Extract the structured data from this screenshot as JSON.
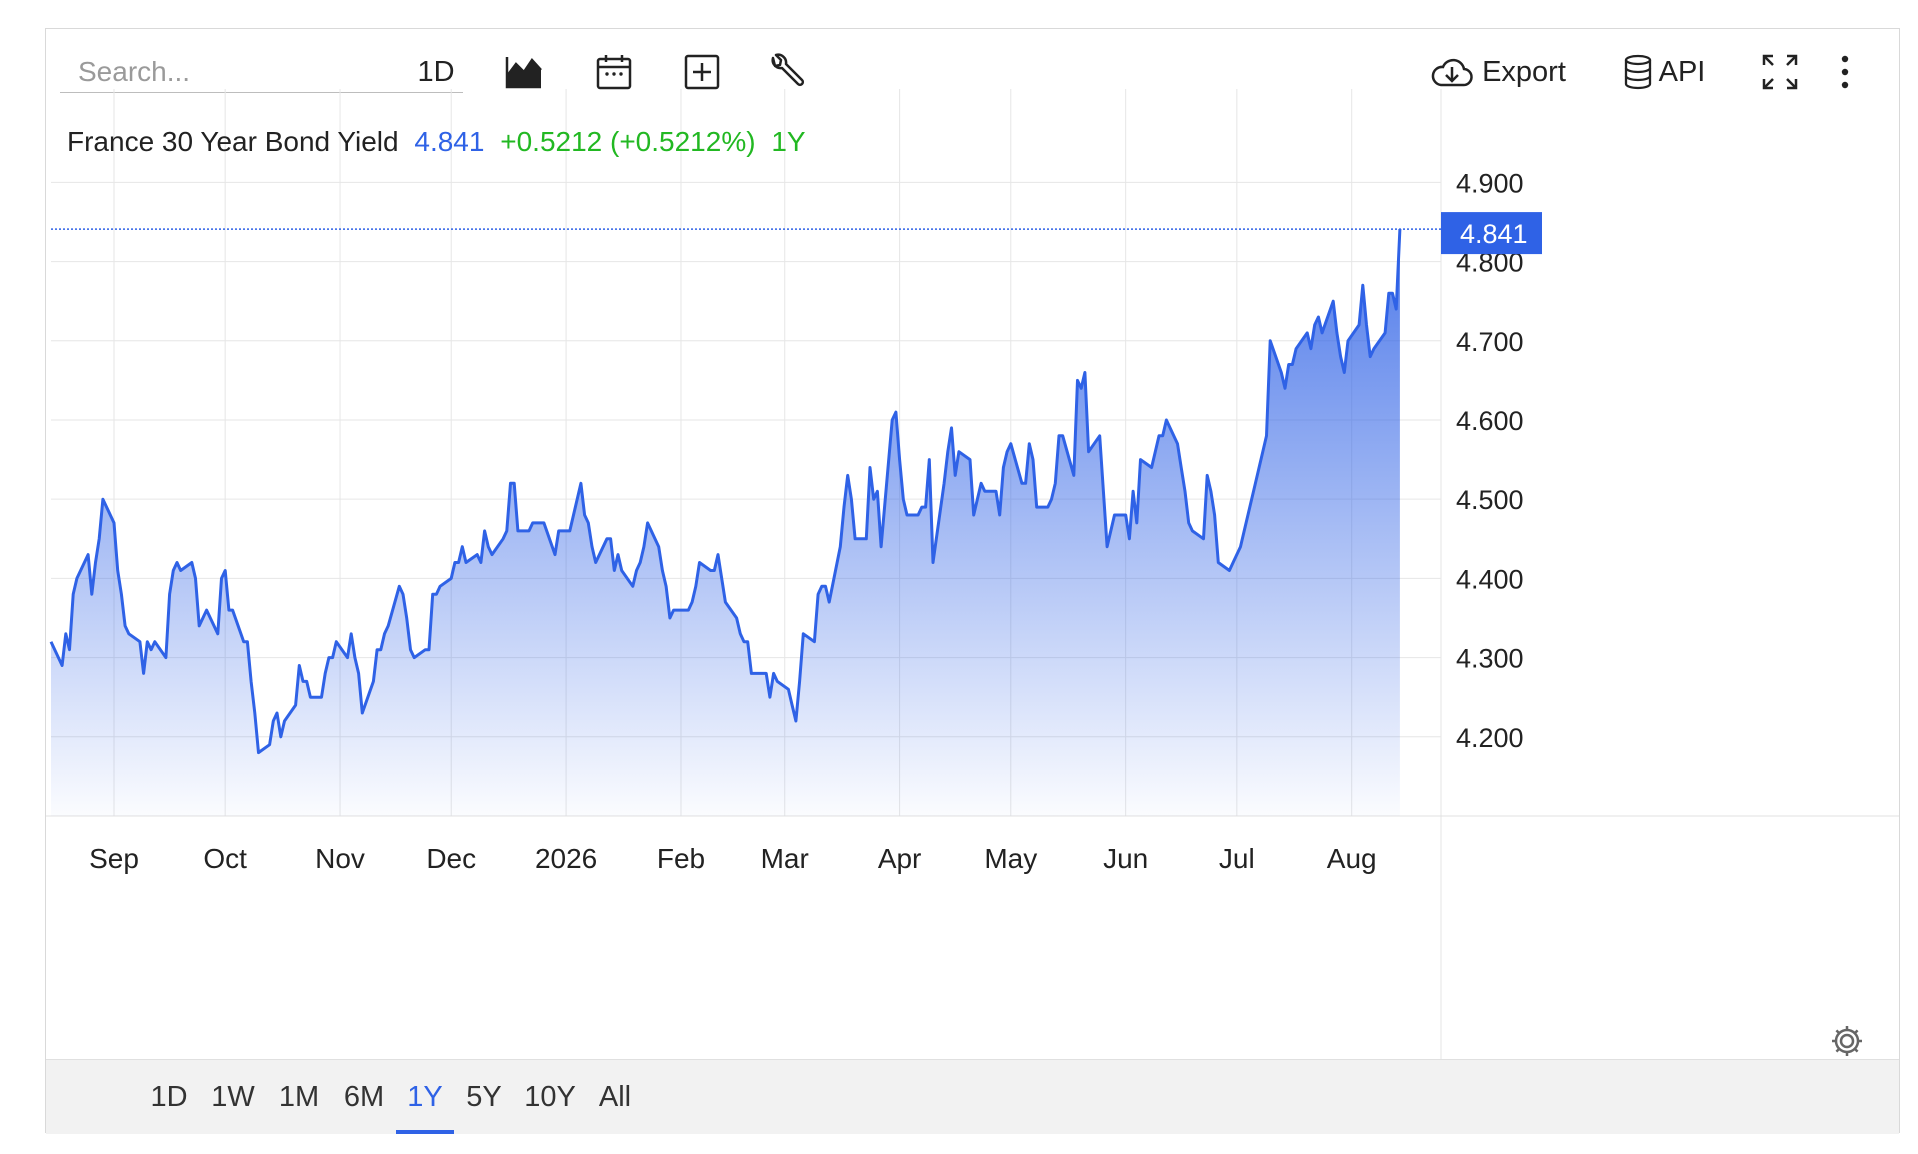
{
  "toolbar": {
    "search_placeholder": "Search...",
    "interval_label": "1D",
    "export_label": "Export",
    "api_label": "API",
    "icons": [
      "chart-type-icon",
      "calendar-icon",
      "compare-plus-icon",
      "wrench-icon",
      "cloud-download-icon",
      "database-icon",
      "fullscreen-icon",
      "more-vertical-icon"
    ]
  },
  "legend": {
    "name": "France 30 Year Bond Yield",
    "value": "4.841",
    "change": "+0.5212 (+0.5212%)",
    "period": "1Y"
  },
  "colors": {
    "line": "#2f62e6",
    "value_text": "#2f62e6",
    "change_text": "#22b822",
    "price_label_bg": "#2f62e6"
  },
  "last_price_label": "4.841",
  "ranges": [
    "1D",
    "1W",
    "1M",
    "6M",
    "1Y",
    "5Y",
    "10Y",
    "All"
  ],
  "active_range": "1Y",
  "chart_data": {
    "type": "area",
    "title": "France 30 Year Bond Yield",
    "ylim": [
      4.1,
      4.98
    ],
    "yticks": [
      4.2,
      4.3,
      4.4,
      4.5,
      4.6,
      4.7,
      4.8,
      4.9
    ],
    "ytick_labels": [
      "4.200",
      "4.300",
      "4.400",
      "4.500",
      "4.600",
      "4.700",
      "4.800",
      "4.900"
    ],
    "xlim": [
      "2025-08-15",
      "2026-08-17"
    ],
    "xticks": [
      {
        "date": "2025-09-01",
        "label": "Sep"
      },
      {
        "date": "2025-10-01",
        "label": "Oct"
      },
      {
        "date": "2025-11-01",
        "label": "Nov"
      },
      {
        "date": "2025-12-01",
        "label": "Dec"
      },
      {
        "date": "2026-01-01",
        "label": "2026"
      },
      {
        "date": "2026-02-01",
        "label": "Feb"
      },
      {
        "date": "2026-03-01",
        "label": "Mar"
      },
      {
        "date": "2026-04-01",
        "label": "Apr"
      },
      {
        "date": "2026-05-01",
        "label": "May"
      },
      {
        "date": "2026-06-01",
        "label": "Jun"
      },
      {
        "date": "2026-07-01",
        "label": "Jul"
      },
      {
        "date": "2026-08-01",
        "label": "Aug"
      }
    ],
    "grid": true,
    "last_value": 4.841,
    "series": [
      {
        "name": "France 30 Year Bond Yield",
        "points": [
          [
            "2025-08-15",
            4.32
          ],
          [
            "2025-08-18",
            4.29
          ],
          [
            "2025-08-19",
            4.33
          ],
          [
            "2025-08-20",
            4.31
          ],
          [
            "2025-08-21",
            4.38
          ],
          [
            "2025-08-22",
            4.4
          ],
          [
            "2025-08-25",
            4.43
          ],
          [
            "2025-08-26",
            4.38
          ],
          [
            "2025-08-27",
            4.42
          ],
          [
            "2025-08-28",
            4.45
          ],
          [
            "2025-08-29",
            4.5
          ],
          [
            "2025-09-01",
            4.47
          ],
          [
            "2025-09-02",
            4.41
          ],
          [
            "2025-09-03",
            4.38
          ],
          [
            "2025-09-04",
            4.34
          ],
          [
            "2025-09-05",
            4.33
          ],
          [
            "2025-09-08",
            4.32
          ],
          [
            "2025-09-09",
            4.28
          ],
          [
            "2025-09-10",
            4.32
          ],
          [
            "2025-09-11",
            4.31
          ],
          [
            "2025-09-12",
            4.32
          ],
          [
            "2025-09-15",
            4.3
          ],
          [
            "2025-09-16",
            4.38
          ],
          [
            "2025-09-17",
            4.41
          ],
          [
            "2025-09-18",
            4.42
          ],
          [
            "2025-09-19",
            4.41
          ],
          [
            "2025-09-22",
            4.42
          ],
          [
            "2025-09-23",
            4.4
          ],
          [
            "2025-09-24",
            4.34
          ],
          [
            "2025-09-25",
            4.35
          ],
          [
            "2025-09-26",
            4.36
          ],
          [
            "2025-09-29",
            4.33
          ],
          [
            "2025-09-30",
            4.4
          ],
          [
            "2025-10-01",
            4.41
          ],
          [
            "2025-10-02",
            4.36
          ],
          [
            "2025-10-03",
            4.36
          ],
          [
            "2025-10-06",
            4.32
          ],
          [
            "2025-10-07",
            4.32
          ],
          [
            "2025-10-08",
            4.27
          ],
          [
            "2025-10-09",
            4.23
          ],
          [
            "2025-10-10",
            4.18
          ],
          [
            "2025-10-13",
            4.19
          ],
          [
            "2025-10-14",
            4.22
          ],
          [
            "2025-10-15",
            4.23
          ],
          [
            "2025-10-16",
            4.2
          ],
          [
            "2025-10-17",
            4.22
          ],
          [
            "2025-10-20",
            4.24
          ],
          [
            "2025-10-21",
            4.29
          ],
          [
            "2025-10-22",
            4.27
          ],
          [
            "2025-10-23",
            4.27
          ],
          [
            "2025-10-24",
            4.25
          ],
          [
            "2025-10-27",
            4.25
          ],
          [
            "2025-10-28",
            4.28
          ],
          [
            "2025-10-29",
            4.3
          ],
          [
            "2025-10-30",
            4.3
          ],
          [
            "2025-10-31",
            4.32
          ],
          [
            "2025-11-03",
            4.3
          ],
          [
            "2025-11-04",
            4.33
          ],
          [
            "2025-11-05",
            4.3
          ],
          [
            "2025-11-06",
            4.28
          ],
          [
            "2025-11-07",
            4.23
          ],
          [
            "2025-11-10",
            4.27
          ],
          [
            "2025-11-11",
            4.31
          ],
          [
            "2025-11-12",
            4.31
          ],
          [
            "2025-11-13",
            4.33
          ],
          [
            "2025-11-14",
            4.34
          ],
          [
            "2025-11-17",
            4.39
          ],
          [
            "2025-11-18",
            4.38
          ],
          [
            "2025-11-19",
            4.35
          ],
          [
            "2025-11-20",
            4.31
          ],
          [
            "2025-11-21",
            4.3
          ],
          [
            "2025-11-24",
            4.31
          ],
          [
            "2025-11-25",
            4.31
          ],
          [
            "2025-11-26",
            4.38
          ],
          [
            "2025-11-27",
            4.38
          ],
          [
            "2025-11-28",
            4.39
          ],
          [
            "2025-12-01",
            4.4
          ],
          [
            "2025-12-02",
            4.42
          ],
          [
            "2025-12-03",
            4.42
          ],
          [
            "2025-12-04",
            4.44
          ],
          [
            "2025-12-05",
            4.42
          ],
          [
            "2025-12-08",
            4.43
          ],
          [
            "2025-12-09",
            4.42
          ],
          [
            "2025-12-10",
            4.46
          ],
          [
            "2025-12-11",
            4.44
          ],
          [
            "2025-12-12",
            4.43
          ],
          [
            "2025-12-15",
            4.45
          ],
          [
            "2025-12-16",
            4.46
          ],
          [
            "2025-12-17",
            4.52
          ],
          [
            "2025-12-18",
            4.52
          ],
          [
            "2025-12-19",
            4.46
          ],
          [
            "2025-12-22",
            4.46
          ],
          [
            "2025-12-23",
            4.47
          ],
          [
            "2025-12-24",
            4.47
          ],
          [
            "2025-12-26",
            4.47
          ],
          [
            "2025-12-29",
            4.43
          ],
          [
            "2025-12-30",
            4.46
          ],
          [
            "2025-12-31",
            4.46
          ],
          [
            "2026-01-02",
            4.46
          ],
          [
            "2026-01-05",
            4.52
          ],
          [
            "2026-01-06",
            4.48
          ],
          [
            "2026-01-07",
            4.47
          ],
          [
            "2026-01-08",
            4.44
          ],
          [
            "2026-01-09",
            4.42
          ],
          [
            "2026-01-12",
            4.45
          ],
          [
            "2026-01-13",
            4.45
          ],
          [
            "2026-01-14",
            4.41
          ],
          [
            "2026-01-15",
            4.43
          ],
          [
            "2026-01-16",
            4.41
          ],
          [
            "2026-01-19",
            4.39
          ],
          [
            "2026-01-20",
            4.41
          ],
          [
            "2026-01-21",
            4.42
          ],
          [
            "2026-01-22",
            4.44
          ],
          [
            "2026-01-23",
            4.47
          ],
          [
            "2026-01-26",
            4.44
          ],
          [
            "2026-01-27",
            4.41
          ],
          [
            "2026-01-28",
            4.39
          ],
          [
            "2026-01-29",
            4.35
          ],
          [
            "2026-01-30",
            4.36
          ],
          [
            "2026-02-02",
            4.36
          ],
          [
            "2026-02-03",
            4.36
          ],
          [
            "2026-02-04",
            4.37
          ],
          [
            "2026-02-05",
            4.39
          ],
          [
            "2026-02-06",
            4.42
          ],
          [
            "2026-02-09",
            4.41
          ],
          [
            "2026-02-10",
            4.41
          ],
          [
            "2026-02-11",
            4.43
          ],
          [
            "2026-02-12",
            4.4
          ],
          [
            "2026-02-13",
            4.37
          ],
          [
            "2026-02-16",
            4.35
          ],
          [
            "2026-02-17",
            4.33
          ],
          [
            "2026-02-18",
            4.32
          ],
          [
            "2026-02-19",
            4.32
          ],
          [
            "2026-02-20",
            4.28
          ],
          [
            "2026-02-23",
            4.28
          ],
          [
            "2026-02-24",
            4.28
          ],
          [
            "2026-02-25",
            4.25
          ],
          [
            "2026-02-26",
            4.28
          ],
          [
            "2026-02-27",
            4.27
          ],
          [
            "2026-03-02",
            4.26
          ],
          [
            "2026-03-03",
            4.24
          ],
          [
            "2026-03-04",
            4.22
          ],
          [
            "2026-03-05",
            4.27
          ],
          [
            "2026-03-06",
            4.33
          ],
          [
            "2026-03-09",
            4.32
          ],
          [
            "2026-03-10",
            4.38
          ],
          [
            "2026-03-11",
            4.39
          ],
          [
            "2026-03-12",
            4.39
          ],
          [
            "2026-03-13",
            4.37
          ],
          [
            "2026-03-16",
            4.44
          ],
          [
            "2026-03-17",
            4.49
          ],
          [
            "2026-03-18",
            4.53
          ],
          [
            "2026-03-19",
            4.5
          ],
          [
            "2026-03-20",
            4.45
          ],
          [
            "2026-03-23",
            4.45
          ],
          [
            "2026-03-24",
            4.54
          ],
          [
            "2026-03-25",
            4.5
          ],
          [
            "2026-03-26",
            4.51
          ],
          [
            "2026-03-27",
            4.44
          ],
          [
            "2026-03-30",
            4.6
          ],
          [
            "2026-03-31",
            4.61
          ],
          [
            "2026-04-01",
            4.55
          ],
          [
            "2026-04-02",
            4.5
          ],
          [
            "2026-04-03",
            4.48
          ],
          [
            "2026-04-06",
            4.48
          ],
          [
            "2026-04-07",
            4.49
          ],
          [
            "2026-04-08",
            4.49
          ],
          [
            "2026-04-09",
            4.55
          ],
          [
            "2026-04-10",
            4.42
          ],
          [
            "2026-04-13",
            4.52
          ],
          [
            "2026-04-14",
            4.56
          ],
          [
            "2026-04-15",
            4.59
          ],
          [
            "2026-04-16",
            4.53
          ],
          [
            "2026-04-17",
            4.56
          ],
          [
            "2026-04-20",
            4.55
          ],
          [
            "2026-04-21",
            4.48
          ],
          [
            "2026-04-22",
            4.5
          ],
          [
            "2026-04-23",
            4.52
          ],
          [
            "2026-04-24",
            4.51
          ],
          [
            "2026-04-27",
            4.51
          ],
          [
            "2026-04-28",
            4.48
          ],
          [
            "2026-04-29",
            4.54
          ],
          [
            "2026-04-30",
            4.56
          ],
          [
            "2026-05-01",
            4.57
          ],
          [
            "2026-05-04",
            4.52
          ],
          [
            "2026-05-05",
            4.52
          ],
          [
            "2026-05-06",
            4.57
          ],
          [
            "2026-05-07",
            4.55
          ],
          [
            "2026-05-08",
            4.49
          ],
          [
            "2026-05-11",
            4.49
          ],
          [
            "2026-05-12",
            4.5
          ],
          [
            "2026-05-13",
            4.52
          ],
          [
            "2026-05-14",
            4.58
          ],
          [
            "2026-05-15",
            4.58
          ],
          [
            "2026-05-18",
            4.53
          ],
          [
            "2026-05-19",
            4.65
          ],
          [
            "2026-05-20",
            4.64
          ],
          [
            "2026-05-21",
            4.66
          ],
          [
            "2026-05-22",
            4.56
          ],
          [
            "2026-05-25",
            4.58
          ],
          [
            "2026-05-26",
            4.51
          ],
          [
            "2026-05-27",
            4.44
          ],
          [
            "2026-05-28",
            4.46
          ],
          [
            "2026-05-29",
            4.48
          ],
          [
            "2026-06-01",
            4.48
          ],
          [
            "2026-06-02",
            4.45
          ],
          [
            "2026-06-03",
            4.51
          ],
          [
            "2026-06-04",
            4.47
          ],
          [
            "2026-06-05",
            4.55
          ],
          [
            "2026-06-08",
            4.54
          ],
          [
            "2026-06-09",
            4.56
          ],
          [
            "2026-06-10",
            4.58
          ],
          [
            "2026-06-11",
            4.58
          ],
          [
            "2026-06-12",
            4.6
          ],
          [
            "2026-06-15",
            4.57
          ],
          [
            "2026-06-16",
            4.54
          ],
          [
            "2026-06-17",
            4.51
          ],
          [
            "2026-06-18",
            4.47
          ],
          [
            "2026-06-19",
            4.46
          ],
          [
            "2026-06-22",
            4.45
          ],
          [
            "2026-06-23",
            4.53
          ],
          [
            "2026-06-24",
            4.51
          ],
          [
            "2026-06-25",
            4.48
          ],
          [
            "2026-06-26",
            4.42
          ],
          [
            "2026-06-29",
            4.41
          ],
          [
            "2026-06-30",
            4.42
          ],
          [
            "2026-07-01",
            4.43
          ],
          [
            "2026-07-02",
            4.44
          ],
          [
            "2026-07-03",
            4.46
          ],
          [
            "2026-07-06",
            4.52
          ],
          [
            "2026-07-07",
            4.54
          ],
          [
            "2026-07-08",
            4.56
          ],
          [
            "2026-07-09",
            4.58
          ],
          [
            "2026-07-10",
            4.7
          ],
          [
            "2026-07-13",
            4.66
          ],
          [
            "2026-07-14",
            4.64
          ],
          [
            "2026-07-15",
            4.67
          ],
          [
            "2026-07-16",
            4.67
          ],
          [
            "2026-07-17",
            4.69
          ],
          [
            "2026-07-20",
            4.71
          ],
          [
            "2026-07-21",
            4.69
          ],
          [
            "2026-07-22",
            4.72
          ],
          [
            "2026-07-23",
            4.73
          ],
          [
            "2026-07-24",
            4.71
          ],
          [
            "2026-07-27",
            4.75
          ],
          [
            "2026-07-28",
            4.71
          ],
          [
            "2026-07-29",
            4.68
          ],
          [
            "2026-07-30",
            4.66
          ],
          [
            "2026-07-31",
            4.7
          ],
          [
            "2026-08-03",
            4.72
          ],
          [
            "2026-08-04",
            4.77
          ],
          [
            "2026-08-05",
            4.72
          ],
          [
            "2026-08-06",
            4.68
          ],
          [
            "2026-08-07",
            4.69
          ],
          [
            "2026-08-10",
            4.71
          ],
          [
            "2026-08-11",
            4.76
          ],
          [
            "2026-08-12",
            4.76
          ],
          [
            "2026-08-13",
            4.74
          ],
          [
            "2026-08-14",
            4.841
          ]
        ]
      }
    ]
  }
}
